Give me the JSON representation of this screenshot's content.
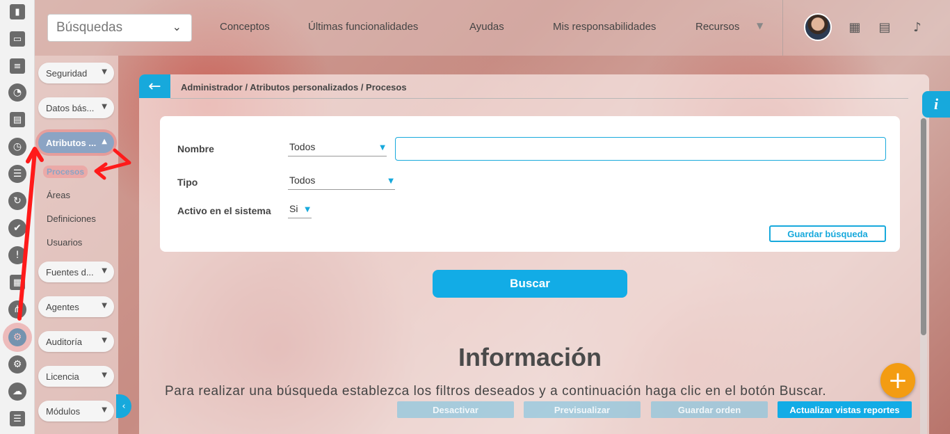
{
  "topbar": {
    "search_select": "Búsquedas",
    "nav": [
      "Conceptos",
      "Últimas funcionalidades",
      "Ayudas",
      "Mis responsabilidades",
      "Recursos"
    ]
  },
  "rail_icons": [
    "bar-chart-icon",
    "presentation-icon",
    "gantt-icon",
    "pie-chart-icon",
    "map-icon",
    "clock-icon",
    "list-icon",
    "refresh-icon",
    "check-circle-icon",
    "warning-icon",
    "calendar-icon",
    "share-icon",
    "gear-icon",
    "gears-icon",
    "cloud-icon",
    "document-icon"
  ],
  "menu": {
    "items": [
      {
        "label": "Seguridad"
      },
      {
        "label": "Datos bás..."
      },
      {
        "label": "Atributos ..."
      },
      {
        "label": "Fuentes d..."
      },
      {
        "label": "Agentes"
      },
      {
        "label": "Auditoría"
      },
      {
        "label": "Licencia"
      },
      {
        "label": "Módulos"
      }
    ],
    "submenu": [
      "Procesos",
      "Áreas",
      "Definiciones",
      "Usuarios"
    ]
  },
  "breadcrumb": "Administrador / Atributos personalizados / Procesos",
  "filters": {
    "nombre_label": "Nombre",
    "nombre_value": "Todos",
    "tipo_label": "Tipo",
    "tipo_value": "Todos",
    "activo_label": "Activo en el sistema",
    "activo_value": "Si",
    "save_search": "Guardar búsqueda"
  },
  "buscar_label": "Buscar",
  "info": {
    "title": "Información",
    "text": "Para realizar una búsqueda establezca los filtros deseados y a continuación haga clic en el botón Buscar."
  },
  "bottom_buttons": [
    "Desactivar",
    "Previsualizar",
    "Guardar orden",
    "Actualizar vistas reportes"
  ],
  "colors": {
    "accent": "#17a9dc",
    "fab": "#f39c12",
    "annotation": "#ff1a1a"
  }
}
